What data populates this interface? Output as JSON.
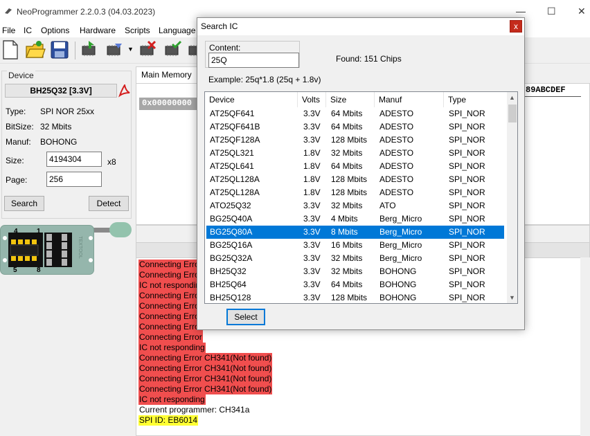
{
  "window": {
    "title": "NeoProgrammer 2.2.0.3 (04.03.2023)",
    "minimize": "—",
    "maximize": "☐",
    "close": "✕"
  },
  "menu": [
    "File",
    "IC",
    "Options",
    "Hardware",
    "Scripts",
    "Language"
  ],
  "device": {
    "group_label": "Device",
    "name": "BH25Q32 [3.3V]",
    "type_label": "Type:",
    "type_value": "SPI NOR  25xx",
    "bitsize_label": "BitSize:",
    "bitsize_value": "32 Mbits",
    "manuf_label": "Manuf:",
    "manuf_value": "BOHONG",
    "size_label": "Size:",
    "size_value": "4194304",
    "size_unit": "x8",
    "page_label": "Page:",
    "page_value": "256",
    "search_button": "Search",
    "detect_button": "Detect"
  },
  "socket": {
    "pin1": "1",
    "pin4": "4",
    "pin5": "5",
    "pin8": "8",
    "brand": "TEXTOOL"
  },
  "main": {
    "tab_label": "Main Memory",
    "hex_address": "0x00000000",
    "hex_header": "89ABCDEF"
  },
  "log": [
    {
      "text": "Connecting Error",
      "style": "err"
    },
    {
      "text": "Connecting Error",
      "style": "err"
    },
    {
      "text": "IC not responding",
      "style": "err"
    },
    {
      "text": "Connecting Error",
      "style": "err"
    },
    {
      "text": "Connecting Error",
      "style": "err"
    },
    {
      "text": "Connecting Error",
      "style": "err"
    },
    {
      "text": "Connecting Error",
      "style": "err"
    },
    {
      "text": "Connecting Error",
      "style": "err"
    },
    {
      "text": "IC not responding",
      "style": "err"
    },
    {
      "text": "Connecting Error CH341(Not found)",
      "style": "err"
    },
    {
      "text": "Connecting Error CH341(Not found)",
      "style": "err"
    },
    {
      "text": "Connecting Error CH341(Not found)",
      "style": "err"
    },
    {
      "text": "Connecting Error CH341(Not found)",
      "style": "err"
    },
    {
      "text": "IC not responding",
      "style": "err"
    },
    {
      "text": "Current programmer: CH341a",
      "style": "plain"
    },
    {
      "text": "SPI ID: EB6014",
      "style": "hl"
    }
  ],
  "dialog": {
    "title": "Search IC",
    "close": "x",
    "content_label": "Content:",
    "content_value": "25Q",
    "found_text": "Found: 151  Chips",
    "example_text": "Example:  25q*1.8 (25q + 1.8v)",
    "columns": [
      "Device",
      "Volts",
      "Size",
      "Manuf",
      "Type"
    ],
    "rows": [
      [
        "AT25QF641",
        "3.3V",
        "64 Mbits",
        "ADESTO",
        "SPI_NOR"
      ],
      [
        "AT25QF641B",
        "3.3V",
        "64 Mbits",
        "ADESTO",
        "SPI_NOR"
      ],
      [
        "AT25QF128A",
        "3.3V",
        "128 Mbits",
        "ADESTO",
        "SPI_NOR"
      ],
      [
        "AT25QL321",
        "1.8V",
        "32 Mbits",
        "ADESTO",
        "SPI_NOR"
      ],
      [
        "AT25QL641",
        "1.8V",
        "64 Mbits",
        "ADESTO",
        "SPI_NOR"
      ],
      [
        "AT25QL128A",
        "1.8V",
        "128 Mbits",
        "ADESTO",
        "SPI_NOR"
      ],
      [
        "AT25QL128A",
        "1.8V",
        "128 Mbits",
        "ADESTO",
        "SPI_NOR"
      ],
      [
        "ATO25Q32",
        "3.3V",
        "32 Mbits",
        "ATO",
        "SPI_NOR"
      ],
      [
        "BG25Q40A",
        "3.3V",
        "4 Mbits",
        "Berg_Micro",
        "SPI_NOR"
      ],
      [
        "BG25Q80A",
        "3.3V",
        "8 Mbits",
        "Berg_Micro",
        "SPI_NOR"
      ],
      [
        "BG25Q16A",
        "3.3V",
        "16 Mbits",
        "Berg_Micro",
        "SPI_NOR"
      ],
      [
        "BG25Q32A",
        "3.3V",
        "32 Mbits",
        "Berg_Micro",
        "SPI_NOR"
      ],
      [
        "BH25Q32",
        "3.3V",
        "32 Mbits",
        "BOHONG",
        "SPI_NOR"
      ],
      [
        "BH25Q64",
        "3.3V",
        "64 Mbits",
        "BOHONG",
        "SPI_NOR"
      ],
      [
        "BH25Q128",
        "3.3V",
        "128 Mbits",
        "BOHONG",
        "SPI_NOR"
      ]
    ],
    "selected_index": 9,
    "select_button": "Select"
  },
  "colors": {
    "selection": "#0078d7",
    "error_bg": "#f04e4e",
    "highlight_bg": "#ffff33",
    "close_red": "#c42b1c"
  }
}
